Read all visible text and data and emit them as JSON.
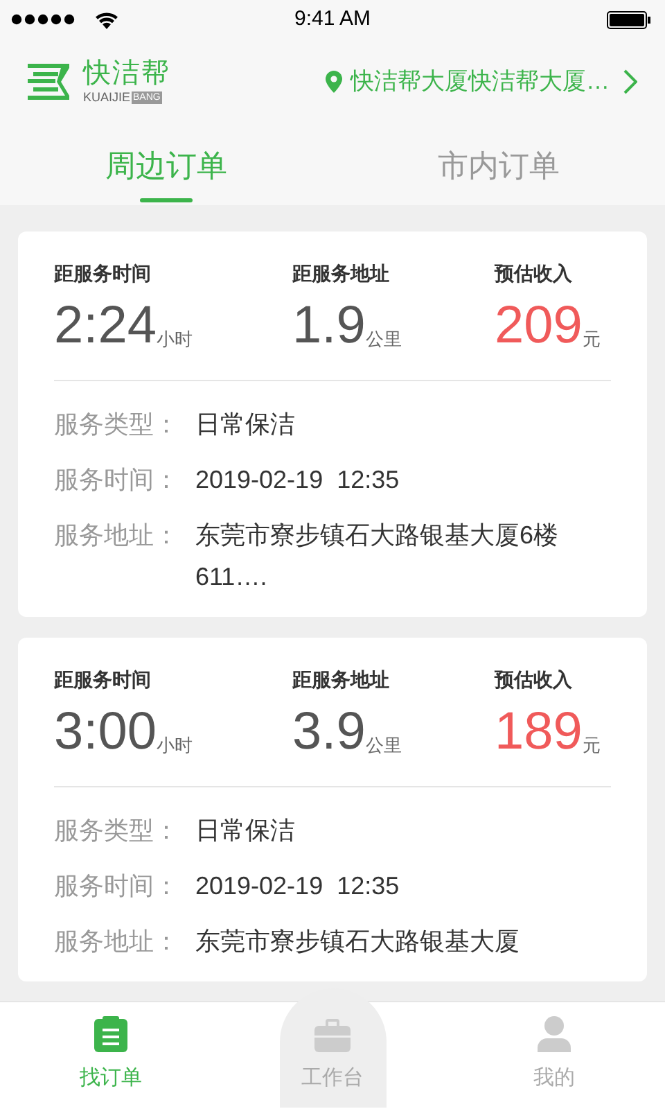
{
  "status_bar": {
    "time": "9:41 AM"
  },
  "header": {
    "logo": {
      "name": "快洁帮",
      "latin": "KUAIJIE",
      "latin_boxed": "BANG"
    },
    "location": "快洁帮大厦快洁帮大厦…"
  },
  "tabs": [
    {
      "label": "周边订单",
      "selected": true
    },
    {
      "label": "市内订单",
      "selected": false
    }
  ],
  "orders": [
    {
      "stats": [
        {
          "kind": "time",
          "label": "距服务时间",
          "value": "2:24",
          "unit": "小时"
        },
        {
          "kind": "distance",
          "label": "距服务地址",
          "value": "1.9",
          "unit": "公里"
        },
        {
          "kind": "income",
          "label": "预估收入",
          "value": "209",
          "unit": "元"
        }
      ],
      "details": [
        {
          "label": "服务类型：",
          "value": "日常保洁"
        },
        {
          "label": "服务时间：",
          "value": "2019-02-19  12:35"
        },
        {
          "label": "服务地址：",
          "value": "东莞市寮步镇石大路银基大厦6楼611…."
        }
      ]
    },
    {
      "stats": [
        {
          "kind": "time",
          "label": "距服务时间",
          "value": "3:00",
          "unit": "小时"
        },
        {
          "kind": "distance",
          "label": "距服务地址",
          "value": "3.9",
          "unit": "公里"
        },
        {
          "kind": "income",
          "label": "预估收入",
          "value": "189",
          "unit": "元"
        }
      ],
      "details": [
        {
          "label": "服务类型：",
          "value": "日常保洁"
        },
        {
          "label": "服务时间：",
          "value": "2019-02-19  12:35"
        },
        {
          "label": "服务地址：",
          "value": "东莞市寮步镇石大路银基大厦"
        }
      ]
    }
  ],
  "bottom_nav": [
    {
      "kind": "tab",
      "label": "找订单",
      "selected": true
    },
    {
      "kind": "raised",
      "label": "工作台",
      "selected": false
    },
    {
      "kind": "tab",
      "label": "我的",
      "selected": false
    }
  ]
}
